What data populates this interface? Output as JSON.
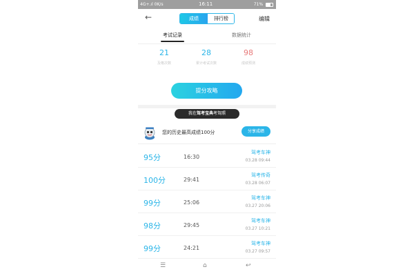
{
  "status_bar": {
    "signal": "4G+.ıl",
    "speed": "0K/s",
    "time": "16:11",
    "battery": "71%"
  },
  "header": {
    "tab_active": "成绩",
    "tab_inactive": "排行榜",
    "edit": "编辑"
  },
  "tabs": {
    "records": "考试记录",
    "stats": "数据统计"
  },
  "stats": [
    {
      "value": "21",
      "label": "及格次数"
    },
    {
      "value": "28",
      "label": "累计考试次数"
    },
    {
      "value": "98",
      "label": "成绩预测"
    }
  ],
  "main_button": "提分攻略",
  "banner": {
    "prefix": "我在",
    "brand": "驾考宝典",
    "suffix": "考驾照"
  },
  "best": {
    "text": "您的历史最高成绩100分",
    "share": "分享成绩"
  },
  "records": [
    {
      "score": "95分",
      "duration": "16:30",
      "title": "驾考车神",
      "date": "03.28  09:44"
    },
    {
      "score": "100分",
      "duration": "29:41",
      "title": "驾考传奇",
      "date": "03.28  06:07"
    },
    {
      "score": "99分",
      "duration": "25:06",
      "title": "驾考车神",
      "date": "03.27  20:06"
    },
    {
      "score": "98分",
      "duration": "29:45",
      "title": "驾考车神",
      "date": "03.27  10:21"
    },
    {
      "score": "99分",
      "duration": "24:21",
      "title": "驾考车神",
      "date": "03.27  09:57"
    }
  ],
  "colors": {
    "accent": "#2bb5e8",
    "prediction": "#e77a7a",
    "banner_bg": "#2b2b2b"
  },
  "icons": {
    "back": "back-arrow-icon",
    "mascot": "mascot-icon",
    "menu": "menu-icon",
    "home": "home-icon",
    "return": "return-icon"
  }
}
